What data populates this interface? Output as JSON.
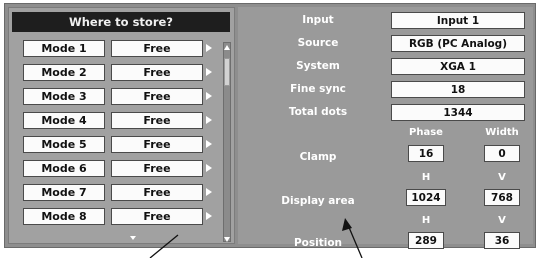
{
  "left_panel": {
    "title": "Where to store?",
    "modes": [
      {
        "name": "Mode 1",
        "status": "Free"
      },
      {
        "name": "Mode 2",
        "status": "Free"
      },
      {
        "name": "Mode 3",
        "status": "Free"
      },
      {
        "name": "Mode 4",
        "status": "Free"
      },
      {
        "name": "Mode 5",
        "status": "Free"
      },
      {
        "name": "Mode 6",
        "status": "Free"
      },
      {
        "name": "Mode 7",
        "status": "Free"
      },
      {
        "name": "Mode 8",
        "status": "Free"
      }
    ]
  },
  "right_panel": {
    "input": {
      "label": "Input",
      "value": "Input 1"
    },
    "source": {
      "label": "Source",
      "value": "RGB (PC Analog)"
    },
    "system": {
      "label": "System",
      "value": "XGA 1"
    },
    "fine_sync": {
      "label": "Fine sync",
      "value": "18"
    },
    "total_dots": {
      "label": "Total dots",
      "value": "1344"
    },
    "clamp": {
      "label": "Clamp",
      "phase_header": "Phase",
      "width_header": "Width",
      "phase": "16",
      "width": "0"
    },
    "display_area": {
      "label": "Display area",
      "h_header": "H",
      "v_header": "V",
      "h": "1024",
      "v": "768"
    },
    "position": {
      "label": "Position",
      "h_header": "H",
      "v_header": "V",
      "h": "289",
      "v": "36"
    }
  },
  "colors": {
    "panel_bg": "#9a9a9a",
    "title_bg": "#1e1e1e",
    "button_bg": "#fbfbfb"
  },
  "icons": [
    "right-arrow-icon",
    "scroll-up-icon",
    "scroll-down-icon",
    "more-down-icon"
  ]
}
